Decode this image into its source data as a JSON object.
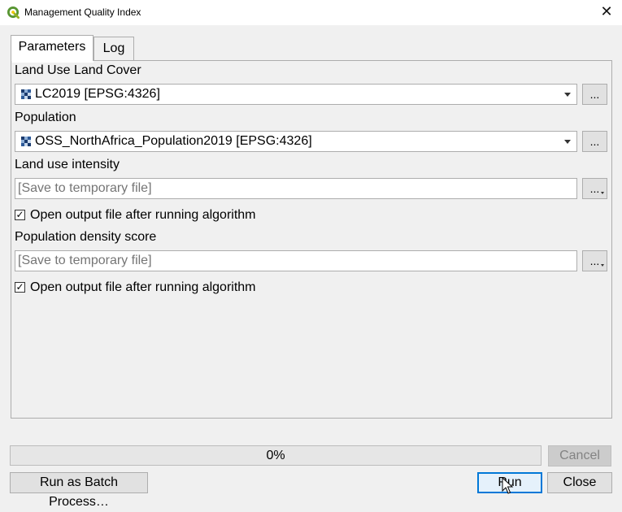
{
  "window": {
    "title": "Management Quality Index",
    "icon": "qgis-logo-icon",
    "close_icon": "close-icon"
  },
  "tabs": [
    {
      "label": "Parameters",
      "active": true
    },
    {
      "label": "Log",
      "active": false
    }
  ],
  "parameters": {
    "land_use": {
      "label": "Land Use Land Cover",
      "value": "LC2019 [EPSG:4326]",
      "browse_label": "..."
    },
    "population": {
      "label": "Population",
      "value": "OSS_NorthAfrica_Population2019 [EPSG:4326]",
      "browse_label": "..."
    },
    "land_use_intensity": {
      "label": "Land use intensity",
      "placeholder": "[Save to temporary file]",
      "browse_label": "...",
      "open_output_label": "Open output file after running algorithm",
      "open_output_checked": true
    },
    "population_density": {
      "label": "Population density score",
      "placeholder": "[Save to temporary file]",
      "browse_label": "...",
      "open_output_label": "Open output file after running algorithm",
      "open_output_checked": true
    }
  },
  "progress": {
    "text": "0%",
    "value": 0
  },
  "buttons": {
    "cancel": "Cancel",
    "batch": "Run as Batch Process…",
    "run": "Run",
    "close": "Close"
  },
  "colors": {
    "accent": "#0078d7",
    "progress_fill": "#06b025",
    "window_bg": "#f0f0f0"
  }
}
